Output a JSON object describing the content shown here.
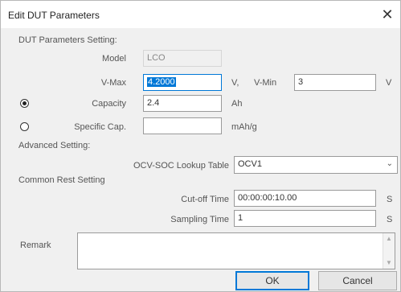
{
  "window": {
    "title": "Edit DUT Parameters",
    "close_glyph": "✕"
  },
  "sections": {
    "dut": "DUT Parameters Setting:",
    "advanced": "Advanced Setting:",
    "rest": "Common Rest Setting"
  },
  "model": {
    "label": "Model",
    "value": "LCO"
  },
  "vmax": {
    "label": "V-Max",
    "value": "4.2000",
    "unit": "V,"
  },
  "vmin": {
    "label": "V-Min",
    "value": "3",
    "unit": "V"
  },
  "capacity": {
    "label": "Capacity",
    "value": "2.4",
    "unit": "Ah",
    "selected": true
  },
  "specific_cap": {
    "label": "Specific Cap.",
    "value": "",
    "unit": "mAh/g",
    "selected": false
  },
  "ocv_table": {
    "label": "OCV-SOC Lookup Table",
    "value": "OCV1"
  },
  "cutoff": {
    "label": "Cut-off Time",
    "value": "00:00:00:10.00",
    "unit": "S"
  },
  "sampling": {
    "label": "Sampling Time",
    "value": "1",
    "unit": "S"
  },
  "remark": {
    "label": "Remark",
    "value": ""
  },
  "buttons": {
    "ok": "OK",
    "cancel": "Cancel"
  },
  "icons": {
    "close": "close-icon",
    "dropdown": "chevron-down-icon",
    "scroll_up": "scroll-up-icon",
    "scroll_down": "scroll-down-icon"
  },
  "colors": {
    "accent": "#0078d7",
    "background": "#f0f0f0"
  }
}
